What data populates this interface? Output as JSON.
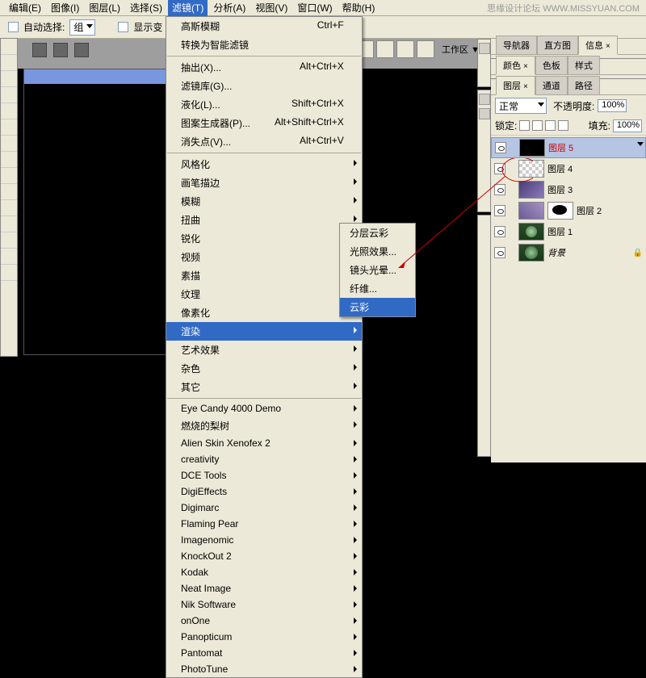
{
  "watermark": "思缘设计论坛  WWW.MISSYUAN.COM",
  "menubar": [
    "编辑(E)",
    "图像(I)",
    "图层(L)",
    "选择(S)",
    "滤镜(T)",
    "分析(A)",
    "视图(V)",
    "窗口(W)",
    "帮助(H)"
  ],
  "active_menu_index": 4,
  "optbar": {
    "auto_select": "自动选择:",
    "group": "组",
    "show": "显示变"
  },
  "workspace_label": "工作区 ▼",
  "filter_menu": {
    "top": [
      {
        "l": "高斯模糊",
        "s": "Ctrl+F"
      },
      {
        "l": "转换为智能滤镜",
        "s": ""
      }
    ],
    "cmds": [
      {
        "l": "抽出(X)...",
        "s": "Alt+Ctrl+X"
      },
      {
        "l": "滤镜库(G)...",
        "s": ""
      },
      {
        "l": "液化(L)...",
        "s": "Shift+Ctrl+X"
      },
      {
        "l": "图案生成器(P)...",
        "s": "Alt+Shift+Ctrl+X"
      },
      {
        "l": "消失点(V)...",
        "s": "Alt+Ctrl+V"
      }
    ],
    "subs": [
      "风格化",
      "画笔描边",
      "模糊",
      "扭曲",
      "锐化",
      "视频",
      "素描",
      "纹理",
      "像素化",
      "渲染",
      "艺术效果",
      "杂色",
      "其它"
    ],
    "highlighted_sub": 9,
    "plugins": [
      "Eye Candy 4000 Demo",
      "燃烧的梨树",
      "Alien Skin Xenofex 2",
      "creativity",
      "DCE Tools",
      "DigiEffects",
      "Digimarc",
      "Flaming Pear",
      "Imagenomic",
      "KnockOut 2",
      "Kodak",
      "Neat Image",
      "Nik Software",
      "onOne",
      "Panopticum",
      "Pantomat",
      "PhotoTune"
    ]
  },
  "render_submenu": {
    "items": [
      "分层云彩",
      "光照效果...",
      "镜头光晕...",
      "纤维...",
      "云彩"
    ],
    "hl": 4
  },
  "panel_tabs_a": [
    "导航器",
    "直方图",
    "信息"
  ],
  "panel_tabs_a_active": 2,
  "panel_tabs_b": [
    "颜色",
    "色板",
    "样式"
  ],
  "panel_tabs_b_active": 0,
  "panel_tabs_c": [
    "图层",
    "通道",
    "路径"
  ],
  "panel_tabs_c_active": 0,
  "layer_opts": {
    "mode": "正常",
    "opacity_l": "不透明度:",
    "opacity_v": "100%",
    "lock": "锁定:",
    "fill_l": "填充:",
    "fill_v": "100%"
  },
  "layers": [
    {
      "name": "图层 5",
      "thumb": "th-black",
      "red": true
    },
    {
      "name": "图层 4",
      "thumb": "th-check"
    },
    {
      "name": "图层 3",
      "thumb": "th-img1"
    },
    {
      "name": "图层 2",
      "thumb": "th-img2",
      "mask": true
    },
    {
      "name": "图层 1",
      "thumb": "th-ph1"
    },
    {
      "name": "背景",
      "thumb": "th-ph2",
      "bg": true
    }
  ]
}
